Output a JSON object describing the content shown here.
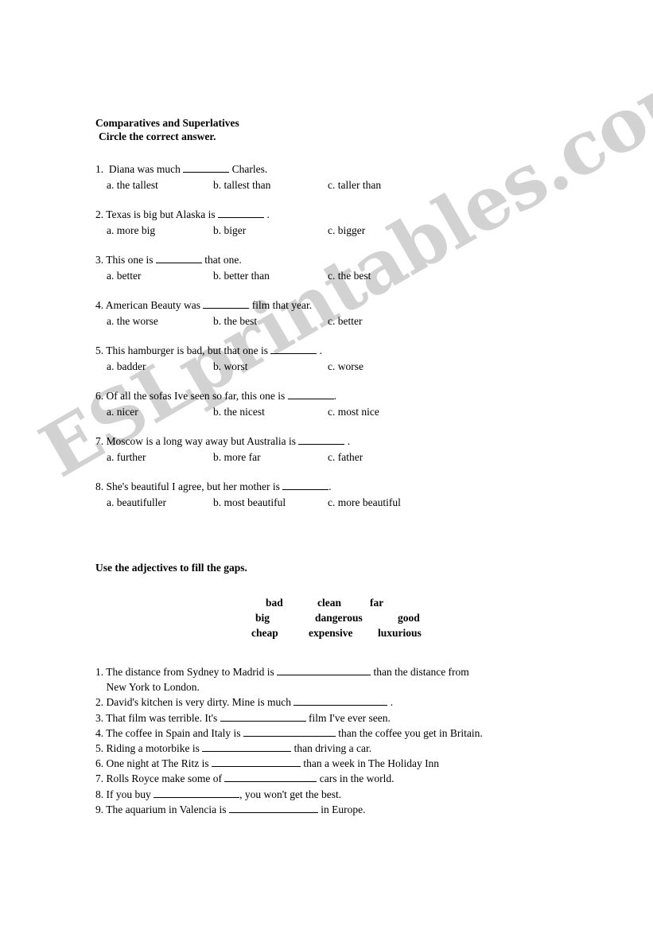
{
  "watermark": {
    "text": "ESLprintables.com",
    "color": "#d2d2d2"
  },
  "worksheet": {
    "title": "Comparatives and Superlatives",
    "instruction": "Circle the correct answer."
  },
  "multiple_choice": [
    {
      "number": "1.",
      "stem_before": "1.  Diana was much ",
      "stem_after": " Charles.",
      "options": {
        "a": "a. the tallest",
        "b": "b. tallest than",
        "c": "c. taller than"
      }
    },
    {
      "number": "2.",
      "stem_before": "2. Texas is big but Alaska is ",
      "stem_after": " .",
      "options": {
        "a": "a. more big",
        "b": "b. biger",
        "c": "c. bigger"
      }
    },
    {
      "number": "3.",
      "stem_before": "3. This one is ",
      "stem_after": " that one.",
      "options": {
        "a": "a. better",
        "b": "b. better than",
        "c": "c. the best"
      }
    },
    {
      "number": "4.",
      "stem_before": "4. American Beauty was ",
      "stem_after": " film that year.",
      "options": {
        "a": "a. the worse",
        "b": "b. the best",
        "c": "c. better"
      }
    },
    {
      "number": "5.",
      "stem_before": "5. This hamburger is bad, but that one is ",
      "stem_after": " .",
      "options": {
        "a": "a. badder",
        "b": "b. worst",
        "c": "c. worse"
      }
    },
    {
      "number": "6.",
      "stem_before": "6. Of all the sofas Ive seen so far, this one is ",
      "stem_after": ".",
      "options": {
        "a": "a. nicer",
        "b": "b. the nicest",
        "c": "c. most nice"
      }
    },
    {
      "number": "7.",
      "stem_before": "7. Moscow is a long way away but Australia is ",
      "stem_after": " .",
      "options": {
        "a": "a. further",
        "b": "b. more far",
        "c": "c. father"
      }
    },
    {
      "number": "8.",
      "stem_before": "8. She's beautiful I agree, but her mother is ",
      "stem_after": ".",
      "options": {
        "a": "a. beautifuller",
        "b": "b. most beautiful",
        "c": "c. more beautiful"
      }
    }
  ],
  "gaps_section": {
    "instruction": "Use the adjectives to fill the gaps.",
    "word_bank": [
      [
        "bad",
        "clean",
        "far"
      ],
      [
        "big",
        "dangerous",
        "good"
      ],
      [
        "cheap",
        "expensive",
        "luxurious"
      ]
    ],
    "items": [
      {
        "before": "1. The distance from Sydney to Madrid is ",
        "after": " than the distance from\n    New York to London."
      },
      {
        "before": "2. David's kitchen is very dirty. Mine is much ",
        "after": " ."
      },
      {
        "before": "3. That film was terrible. It's ",
        "after": " film I've ever seen."
      },
      {
        "before": "4. The coffee in Spain and Italy is ",
        "after": " than the coffee you get in Britain."
      },
      {
        "before": "5. Riding a motorbike is ",
        "after": " than driving a car."
      },
      {
        "before": "6. One night at The Ritz is ",
        "after": " than a week in The Holiday Inn"
      },
      {
        "before": "7. Rolls Royce make some of ",
        "after": " cars in the world."
      },
      {
        "before": "8. If you buy ",
        "after": ", you won't get the best."
      },
      {
        "before": "9. The aquarium in Valencia is ",
        "after": " in Europe."
      }
    ]
  }
}
